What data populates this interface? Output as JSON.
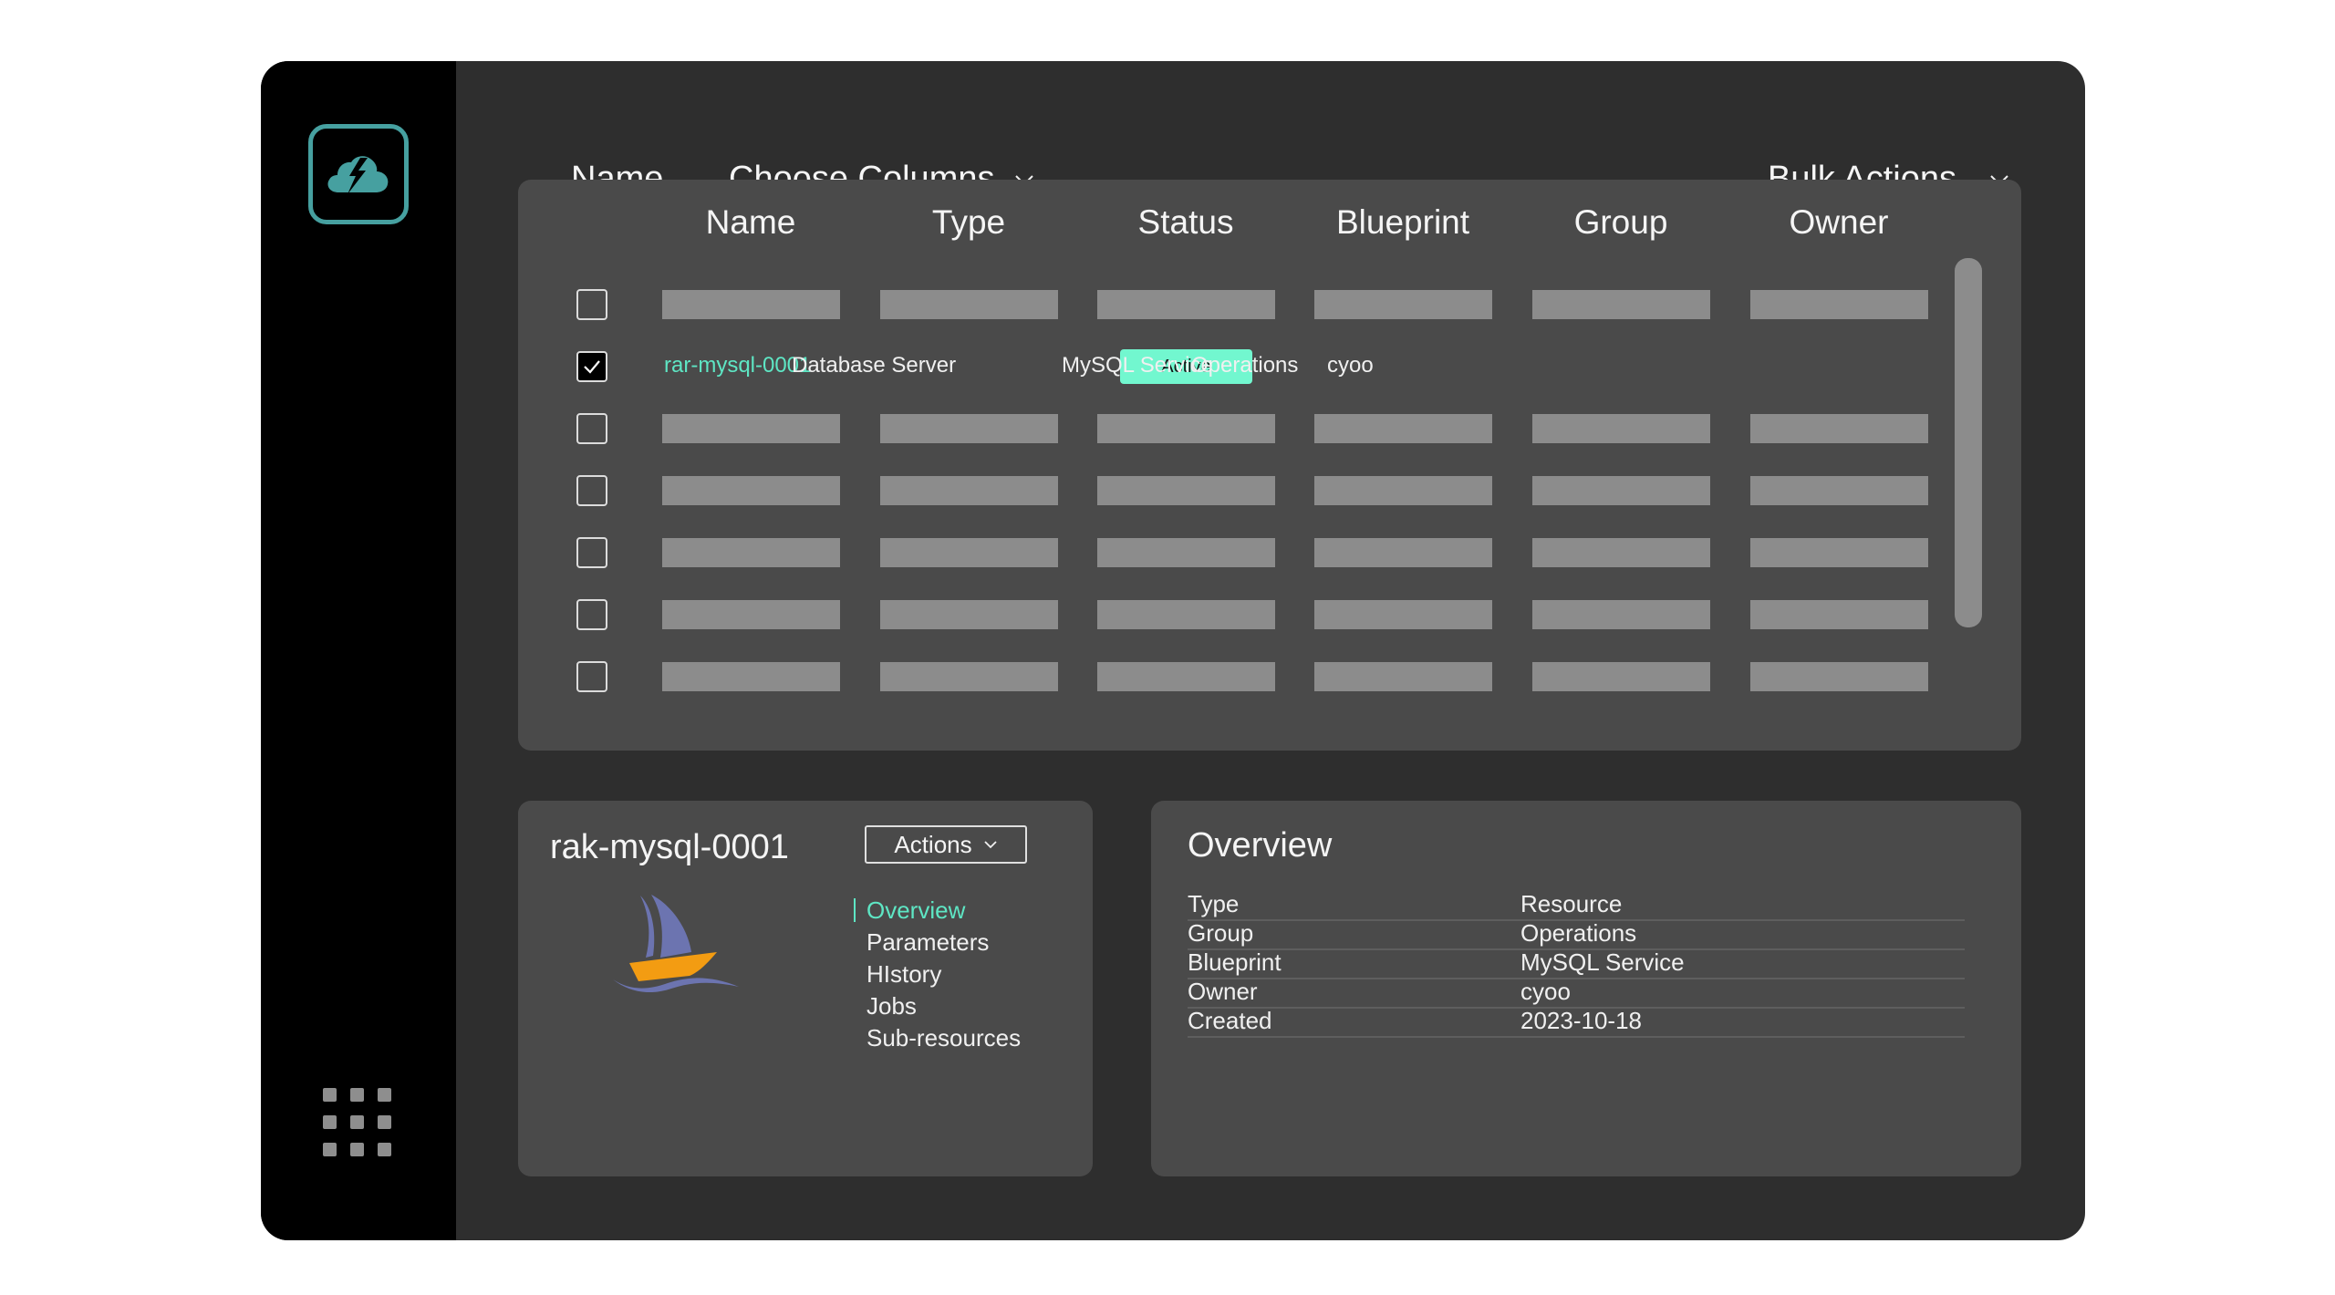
{
  "sidebar": {
    "logo_icon": "cloud-lightning-icon",
    "apps_icon": "grid-icon"
  },
  "topbar": {
    "name_label": "Name",
    "choose_columns_label": "Choose Columns",
    "bulk_actions_label": "Bulk Actions"
  },
  "table": {
    "columns": [
      "Name",
      "Type",
      "Status",
      "Blueprint",
      "Group",
      "Owner"
    ],
    "rows": [
      {
        "checked": false,
        "placeholder": true
      },
      {
        "checked": true,
        "placeholder": false,
        "name": "rar-mysql-0001",
        "type": "Database Server",
        "status": "Active",
        "blueprint": "MySQL Service",
        "group": "Operations",
        "owner": "cyoo"
      },
      {
        "checked": false,
        "placeholder": true
      },
      {
        "checked": false,
        "placeholder": true
      },
      {
        "checked": false,
        "placeholder": true
      },
      {
        "checked": false,
        "placeholder": true
      },
      {
        "checked": false,
        "placeholder": true
      }
    ],
    "status_color": "#72f7cf",
    "link_color": "#5ee6c4"
  },
  "detail": {
    "title": "rak-mysql-0001",
    "actions_label": "Actions",
    "image_icon": "sailboat-icon",
    "nav": [
      {
        "label": "Overview",
        "active": true
      },
      {
        "label": "Parameters",
        "active": false
      },
      {
        "label": "HIstory",
        "active": false
      },
      {
        "label": "Jobs",
        "active": false
      },
      {
        "label": "Sub-resources",
        "active": false
      }
    ]
  },
  "overview": {
    "title": "Overview",
    "rows": [
      {
        "key": "Type",
        "value": "Resource"
      },
      {
        "key": "Group",
        "value": "Operations"
      },
      {
        "key": "Blueprint",
        "value": "MySQL Service"
      },
      {
        "key": "Owner",
        "value": "cyoo"
      },
      {
        "key": "Created",
        "value": "2023-10-18"
      }
    ]
  }
}
